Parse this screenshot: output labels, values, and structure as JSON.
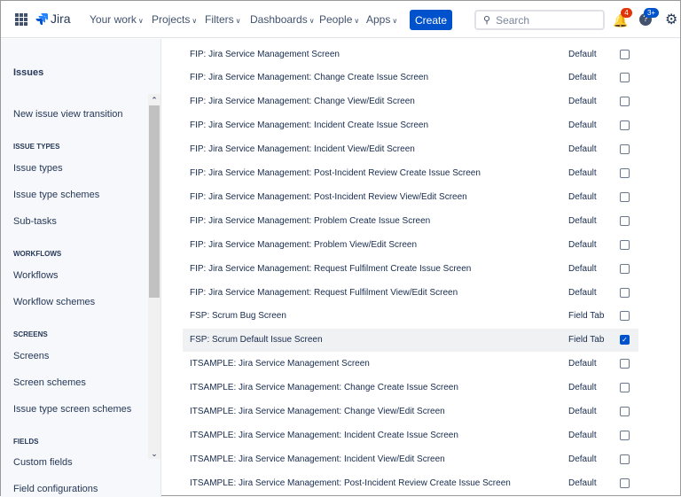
{
  "header": {
    "logo": "Jira",
    "nav": [
      "Your work",
      "Projects",
      "Filters",
      "Dashboards",
      "People",
      "Apps"
    ],
    "create": "Create",
    "search_placeholder": "Search",
    "notifications_count": "4",
    "help_count": "3+"
  },
  "sidebar": {
    "title": "Issues",
    "items": [
      {
        "type": "item",
        "label": "New issue view transition"
      },
      {
        "type": "section",
        "label": "ISSUE TYPES"
      },
      {
        "type": "item",
        "label": "Issue types"
      },
      {
        "type": "item",
        "label": "Issue type schemes"
      },
      {
        "type": "item",
        "label": "Sub-tasks"
      },
      {
        "type": "section",
        "label": "WORKFLOWS"
      },
      {
        "type": "item",
        "label": "Workflows"
      },
      {
        "type": "item",
        "label": "Workflow schemes"
      },
      {
        "type": "section",
        "label": "SCREENS"
      },
      {
        "type": "item",
        "label": "Screens"
      },
      {
        "type": "item",
        "label": "Screen schemes"
      },
      {
        "type": "item",
        "label": "Issue type screen schemes"
      },
      {
        "type": "section",
        "label": "FIELDS"
      },
      {
        "type": "item",
        "label": "Custom fields"
      },
      {
        "type": "item",
        "label": "Field configurations"
      }
    ]
  },
  "rows": [
    {
      "name": "FIP: Jira Service Management Screen",
      "tab": "Default",
      "checked": false
    },
    {
      "name": "FIP: Jira Service Management: Change Create Issue Screen",
      "tab": "Default",
      "checked": false
    },
    {
      "name": "FIP: Jira Service Management: Change View/Edit Screen",
      "tab": "Default",
      "checked": false
    },
    {
      "name": "FIP: Jira Service Management: Incident Create Issue Screen",
      "tab": "Default",
      "checked": false
    },
    {
      "name": "FIP: Jira Service Management: Incident View/Edit Screen",
      "tab": "Default",
      "checked": false
    },
    {
      "name": "FIP: Jira Service Management: Post-Incident Review Create Issue Screen",
      "tab": "Default",
      "checked": false
    },
    {
      "name": "FIP: Jira Service Management: Post-Incident Review View/Edit Screen",
      "tab": "Default",
      "checked": false
    },
    {
      "name": "FIP: Jira Service Management: Problem Create Issue Screen",
      "tab": "Default",
      "checked": false
    },
    {
      "name": "FIP: Jira Service Management: Problem View/Edit Screen",
      "tab": "Default",
      "checked": false
    },
    {
      "name": "FIP: Jira Service Management: Request Fulfilment Create Issue Screen",
      "tab": "Default",
      "checked": false
    },
    {
      "name": "FIP: Jira Service Management: Request Fulfilment View/Edit Screen",
      "tab": "Default",
      "checked": false
    },
    {
      "name": "FSP: Scrum Bug Screen",
      "tab": "Field Tab",
      "checked": false
    },
    {
      "name": "FSP: Scrum Default Issue Screen",
      "tab": "Field Tab",
      "checked": true
    },
    {
      "name": "ITSAMPLE: Jira Service Management Screen",
      "tab": "Default",
      "checked": false
    },
    {
      "name": "ITSAMPLE: Jira Service Management: Change Create Issue Screen",
      "tab": "Default",
      "checked": false
    },
    {
      "name": "ITSAMPLE: Jira Service Management: Change View/Edit Screen",
      "tab": "Default",
      "checked": false
    },
    {
      "name": "ITSAMPLE: Jira Service Management: Incident Create Issue Screen",
      "tab": "Default",
      "checked": false
    },
    {
      "name": "ITSAMPLE: Jira Service Management: Incident View/Edit Screen",
      "tab": "Default",
      "checked": false
    },
    {
      "name": "ITSAMPLE: Jira Service Management: Post-Incident Review Create Issue Screen",
      "tab": "Default",
      "checked": false
    }
  ]
}
